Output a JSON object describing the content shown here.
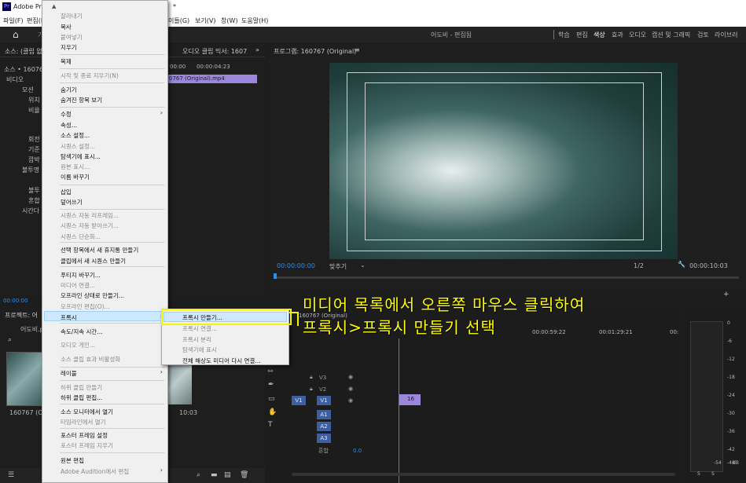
{
  "titlebar": {
    "app_title": "Adobe Prem",
    "suffix": "*"
  },
  "menubar": {
    "items": [
      "파일(F)",
      "편집(E",
      "이들(G)",
      "보기(V)",
      "창(W)",
      "도움말(H)"
    ]
  },
  "header": {
    "home_fragment": "가",
    "center_title": "어도비 - 편집됨",
    "workspaces": [
      "학습",
      "편집",
      "색상",
      "효과",
      "오디오",
      "캡션 및 그래픽",
      "검토",
      "라이브러"
    ]
  },
  "source_panel": {
    "tab1": "소스: (클립 없",
    "tab2": "오디오 클립 믹서: 1607",
    "clip_label": "소스 • 160767",
    "video_label": "비디오",
    "rows": [
      "모션",
      "위치",
      "비율",
      "회전",
      "기준",
      "깜박",
      "불투명",
      "불투",
      "혼합",
      "시간다"
    ],
    "clip_bar": "0767 (Original).mp4",
    "timecode_top": "00:00:04:23",
    "timecode_top2": "00:00",
    "bottom_tc": "00:00:00"
  },
  "program": {
    "title": "프로그램: 160767 (Original)",
    "timecode": "00:00:00:00",
    "fit": "맞추기",
    "quality": "1/2",
    "duration": "00:00:10:03"
  },
  "project": {
    "title": "프로젝트: 어",
    "name": "어도비.p",
    "thumb_label": "160767 (Ori",
    "thumb2_duration": "10:03"
  },
  "timeline": {
    "title": "160767 (Original)",
    "time1": "00:00:59:22",
    "time2": "00:01:29:21",
    "time3": "00:",
    "clip_label": "16",
    "tracks": [
      {
        "name": "V3",
        "type": "video"
      },
      {
        "name": "V2",
        "type": "video"
      },
      {
        "name": "V1",
        "type": "video",
        "source": "V1"
      },
      {
        "name": "A1",
        "type": "audio"
      },
      {
        "name": "A2",
        "type": "audio"
      },
      {
        "name": "A3",
        "type": "audio"
      }
    ],
    "master_label": "혼합",
    "master_value": "0.0"
  },
  "meters": {
    "labels": [
      "0",
      "-6",
      "-12",
      "-18",
      "-24",
      "-30",
      "-36",
      "-42",
      "-48",
      "-54",
      "dB"
    ],
    "solo": [
      "S",
      "S"
    ]
  },
  "context_menu": {
    "items": [
      {
        "label": "잘라내기",
        "disabled": true
      },
      {
        "label": "복사",
        "disabled": false
      },
      {
        "label": "붙여넣기",
        "disabled": true
      },
      {
        "label": "지우기",
        "disabled": false
      },
      {
        "label": "복제",
        "disabled": false
      },
      {
        "label": "시작 및 종료 지우기(N)",
        "disabled": true
      },
      {
        "label": "숨기기",
        "disabled": false
      },
      {
        "label": "숨겨진 항목 보기",
        "disabled": false
      },
      {
        "label": "수정",
        "disabled": false,
        "submenu": true
      },
      {
        "label": "속성...",
        "disabled": false
      },
      {
        "label": "소스 설정...",
        "disabled": false
      },
      {
        "label": "시퀀스 설정...",
        "disabled": true
      },
      {
        "label": "탐색기에 표시...",
        "disabled": false
      },
      {
        "label": "원본 표시...",
        "disabled": true
      },
      {
        "label": "이름 바꾸기",
        "disabled": false
      },
      {
        "label": "삽입",
        "disabled": false
      },
      {
        "label": "덮어쓰기",
        "disabled": false
      },
      {
        "label": "시퀀스 자동 리프레임...",
        "disabled": true
      },
      {
        "label": "시퀀스 자동 받아쓰기...",
        "disabled": true
      },
      {
        "label": "시퀀스 단순화...",
        "disabled": true
      },
      {
        "label": "선택 항목에서 새 휴지통 만들기",
        "disabled": false
      },
      {
        "label": "클립에서 새 시퀀스 만들기",
        "disabled": false
      },
      {
        "label": "푸티지 바꾸기...",
        "disabled": false
      },
      {
        "label": "미디어 연결...",
        "disabled": true
      },
      {
        "label": "오프라인 상태로 만들기...",
        "disabled": false
      },
      {
        "label": "오프라인 편집(O)...",
        "disabled": true
      },
      {
        "label": "프록시",
        "disabled": false,
        "submenu": true
      },
      {
        "label": "속도/지속 시간...",
        "disabled": false
      },
      {
        "label": "오디오 게인...",
        "disabled": true
      },
      {
        "label": "소스 클립 효과 비활성화",
        "disabled": true
      },
      {
        "label": "레이블",
        "disabled": false,
        "submenu": true
      },
      {
        "label": "하위 클립 만들기",
        "disabled": true
      },
      {
        "label": "하위 클립 편집...",
        "disabled": false
      },
      {
        "label": "소스 모니터에서 열기",
        "disabled": false
      },
      {
        "label": "타임라인에서 열기",
        "disabled": true
      },
      {
        "label": "포스터 프레임 설정",
        "disabled": false
      },
      {
        "label": "포스터 프레임 지우기",
        "disabled": true
      },
      {
        "label": "원본 편집",
        "disabled": false
      },
      {
        "label": "Adobe Audition에서 편집",
        "disabled": true,
        "submenu": true
      }
    ]
  },
  "submenu": {
    "items": [
      {
        "label": "프록시 만들기...",
        "disabled": false
      },
      {
        "label": "프록시 연결...",
        "disabled": true
      },
      {
        "label": "프록시 분리",
        "disabled": true
      },
      {
        "label": "탐색기에 표시",
        "disabled": true
      },
      {
        "label": "전체 해상도 미디어 다시 연결...",
        "disabled": false
      }
    ]
  },
  "annotation": {
    "line1": "미디어 목록에서 오른쪽 마우스 클릭하여",
    "line2": "프록시>프록시 만들기 선택"
  },
  "colors": {
    "highlight": "#f5f500",
    "accent_blue": "#2d8ceb",
    "clip_purple": "#9a87d9"
  }
}
